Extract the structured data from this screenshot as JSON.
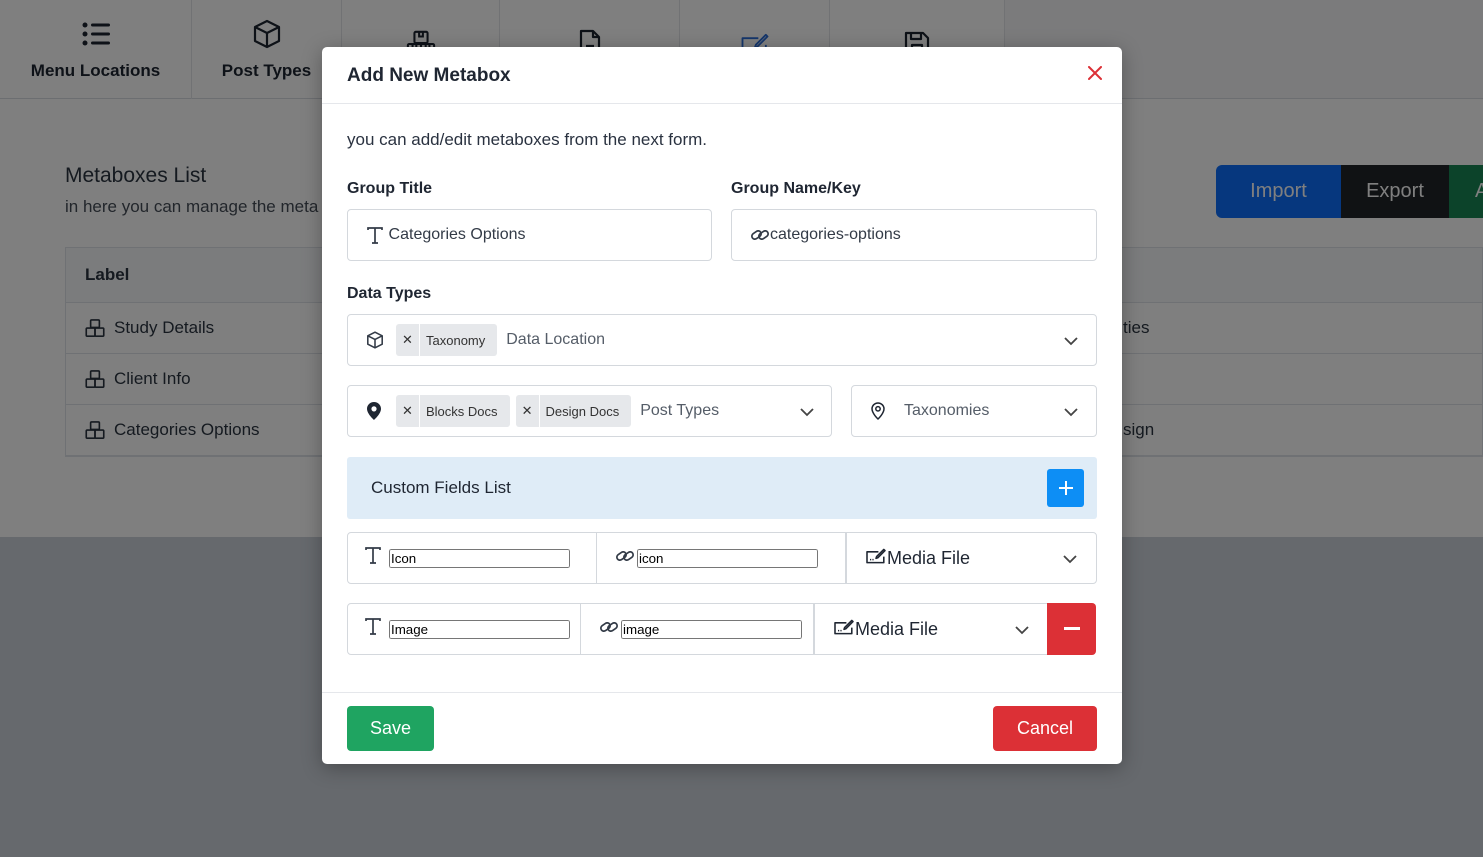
{
  "toolbar": {
    "items": [
      {
        "label": "Menu Locations",
        "icon": "list-icon"
      },
      {
        "label": "Post Types",
        "icon": "cube-icon"
      },
      {
        "label": "",
        "icon": "boxes-icon"
      },
      {
        "label": "",
        "icon": "document-icon"
      },
      {
        "label": "",
        "icon": "form-edit-icon"
      },
      {
        "label": "",
        "icon": "floppy-icon"
      }
    ]
  },
  "page": {
    "list_title": "Metaboxes List",
    "list_subtitle": "in here you can manage the meta",
    "import_label": "Import",
    "export_label": "Export",
    "add_label": "A",
    "table": {
      "header_label": "Label",
      "rows": [
        {
          "label": "Study Details",
          "right": "ties"
        },
        {
          "label": "Client Info",
          "right": ""
        },
        {
          "label": "Categories Options",
          "right": "sign"
        }
      ]
    }
  },
  "modal": {
    "title": "Add New Metabox",
    "description": "you can add/edit metaboxes from the next form.",
    "group_title_label": "Group Title",
    "group_title_value": "Categories Options",
    "group_key_label": "Group Name/Key",
    "group_key_value": "categories-options",
    "data_types_label": "Data Types",
    "data_location": {
      "tags": [
        "Taxonomy"
      ],
      "placeholder": "Data Location"
    },
    "post_types": {
      "tags": [
        "Blocks Docs",
        "Design Docs"
      ],
      "placeholder": "Post Types"
    },
    "taxonomies": {
      "placeholder": "Taxonomies"
    },
    "custom_fields_title": "Custom Fields List",
    "fields": [
      {
        "label": "Icon",
        "key": "icon",
        "type": "Media File"
      },
      {
        "label": "Image",
        "key": "image",
        "type": "Media File"
      }
    ],
    "save_label": "Save",
    "cancel_label": "Cancel"
  },
  "colors": {
    "primary": "#0d8ef5",
    "save": "#1fa461",
    "danger": "#dc3036",
    "close": "#dc3036",
    "custom_fields_bg": "#dfecf7"
  }
}
